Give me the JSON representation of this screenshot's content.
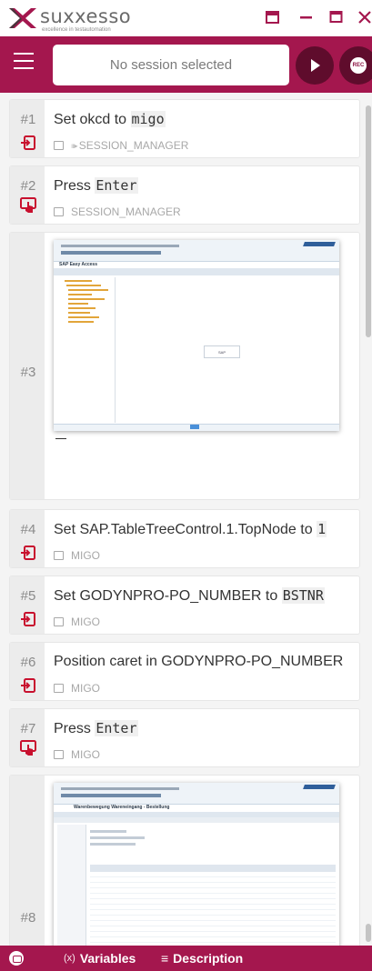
{
  "app": {
    "brand": "suxxesso",
    "tagline": "excellence in testautomation"
  },
  "toolbar": {
    "session_text": "No session selected"
  },
  "steps": [
    {
      "num": "#1",
      "pre": "Set okcd to ",
      "code": "migo",
      "post": "",
      "meta": "SESSION_MANAGER",
      "icon": "input-icon"
    },
    {
      "num": "#2",
      "pre": "Press ",
      "code": "Enter",
      "post": "",
      "meta": "SESSION_MANAGER",
      "icon": "keypress-icon"
    },
    {
      "num": "#3",
      "pre": "",
      "code": "",
      "post": "",
      "meta": "",
      "icon": "screenshot"
    },
    {
      "num": "#4",
      "pre": "Set SAP.TableTreeControl.1.TopNode to ",
      "code": "1",
      "post": "",
      "meta": "MIGO",
      "icon": "input-icon"
    },
    {
      "num": "#5",
      "pre": "Set GODYNPRO-PO_NUMBER to ",
      "code": "BSTNR",
      "post": "",
      "meta": "MIGO",
      "icon": "input-icon"
    },
    {
      "num": "#6",
      "pre": "Position caret in GODYNPRO-PO_NUMBER",
      "code": "",
      "post": "",
      "meta": "MIGO",
      "icon": "input-icon"
    },
    {
      "num": "#7",
      "pre": "Press ",
      "code": "Enter",
      "post": "",
      "meta": "MIGO",
      "icon": "keypress-icon"
    },
    {
      "num": "#8",
      "pre": "",
      "code": "",
      "post": "",
      "meta": "",
      "icon": "screenshot"
    }
  ],
  "shot1": {
    "title": "SAP Easy Access",
    "center_text": "SAP"
  },
  "shot2": {
    "title": "Warenbewegung Wareneingang - Bestellung"
  },
  "statusbar": {
    "variables_icon": "(x)",
    "variables_label": "Variables",
    "description_icon": "≡",
    "description_label": "Description"
  },
  "colors": {
    "brand": "#a4174e",
    "brand_dark": "#5f0c2c",
    "step_icon": "#c8102e"
  }
}
